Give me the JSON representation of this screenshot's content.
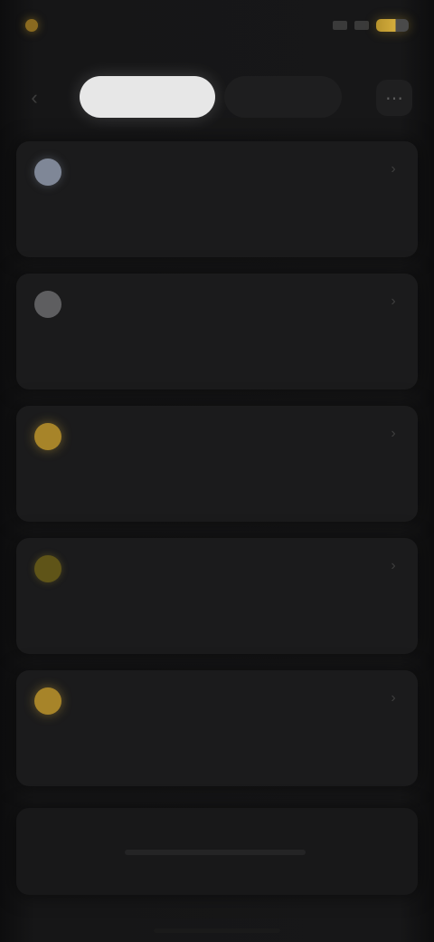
{
  "status_bar": {
    "time": "",
    "battery_color": "#d4ad3d"
  },
  "nav": {
    "tabs": [
      {
        "label": "",
        "active": true
      },
      {
        "label": "",
        "active": false
      }
    ]
  },
  "cards": [
    {
      "icon": "info-icon",
      "icon_color": "#7f8797",
      "title": "",
      "body": ""
    },
    {
      "icon": "info-icon",
      "icon_color": "#5e5e60",
      "title": "",
      "body": ""
    },
    {
      "icon": "warning-icon",
      "icon_color": "#a78429",
      "title": "",
      "body": ""
    },
    {
      "icon": "warning-icon",
      "icon_color": "#5f5418",
      "title": "",
      "body": ""
    },
    {
      "icon": "warning-icon",
      "icon_color": "#a78429",
      "title": "",
      "body": ""
    }
  ],
  "colors": {
    "background": "#0b0b0c",
    "card": "#1b1b1c",
    "accent_gold": "#d4ad3d",
    "active_tab": "#e7e7e7"
  }
}
